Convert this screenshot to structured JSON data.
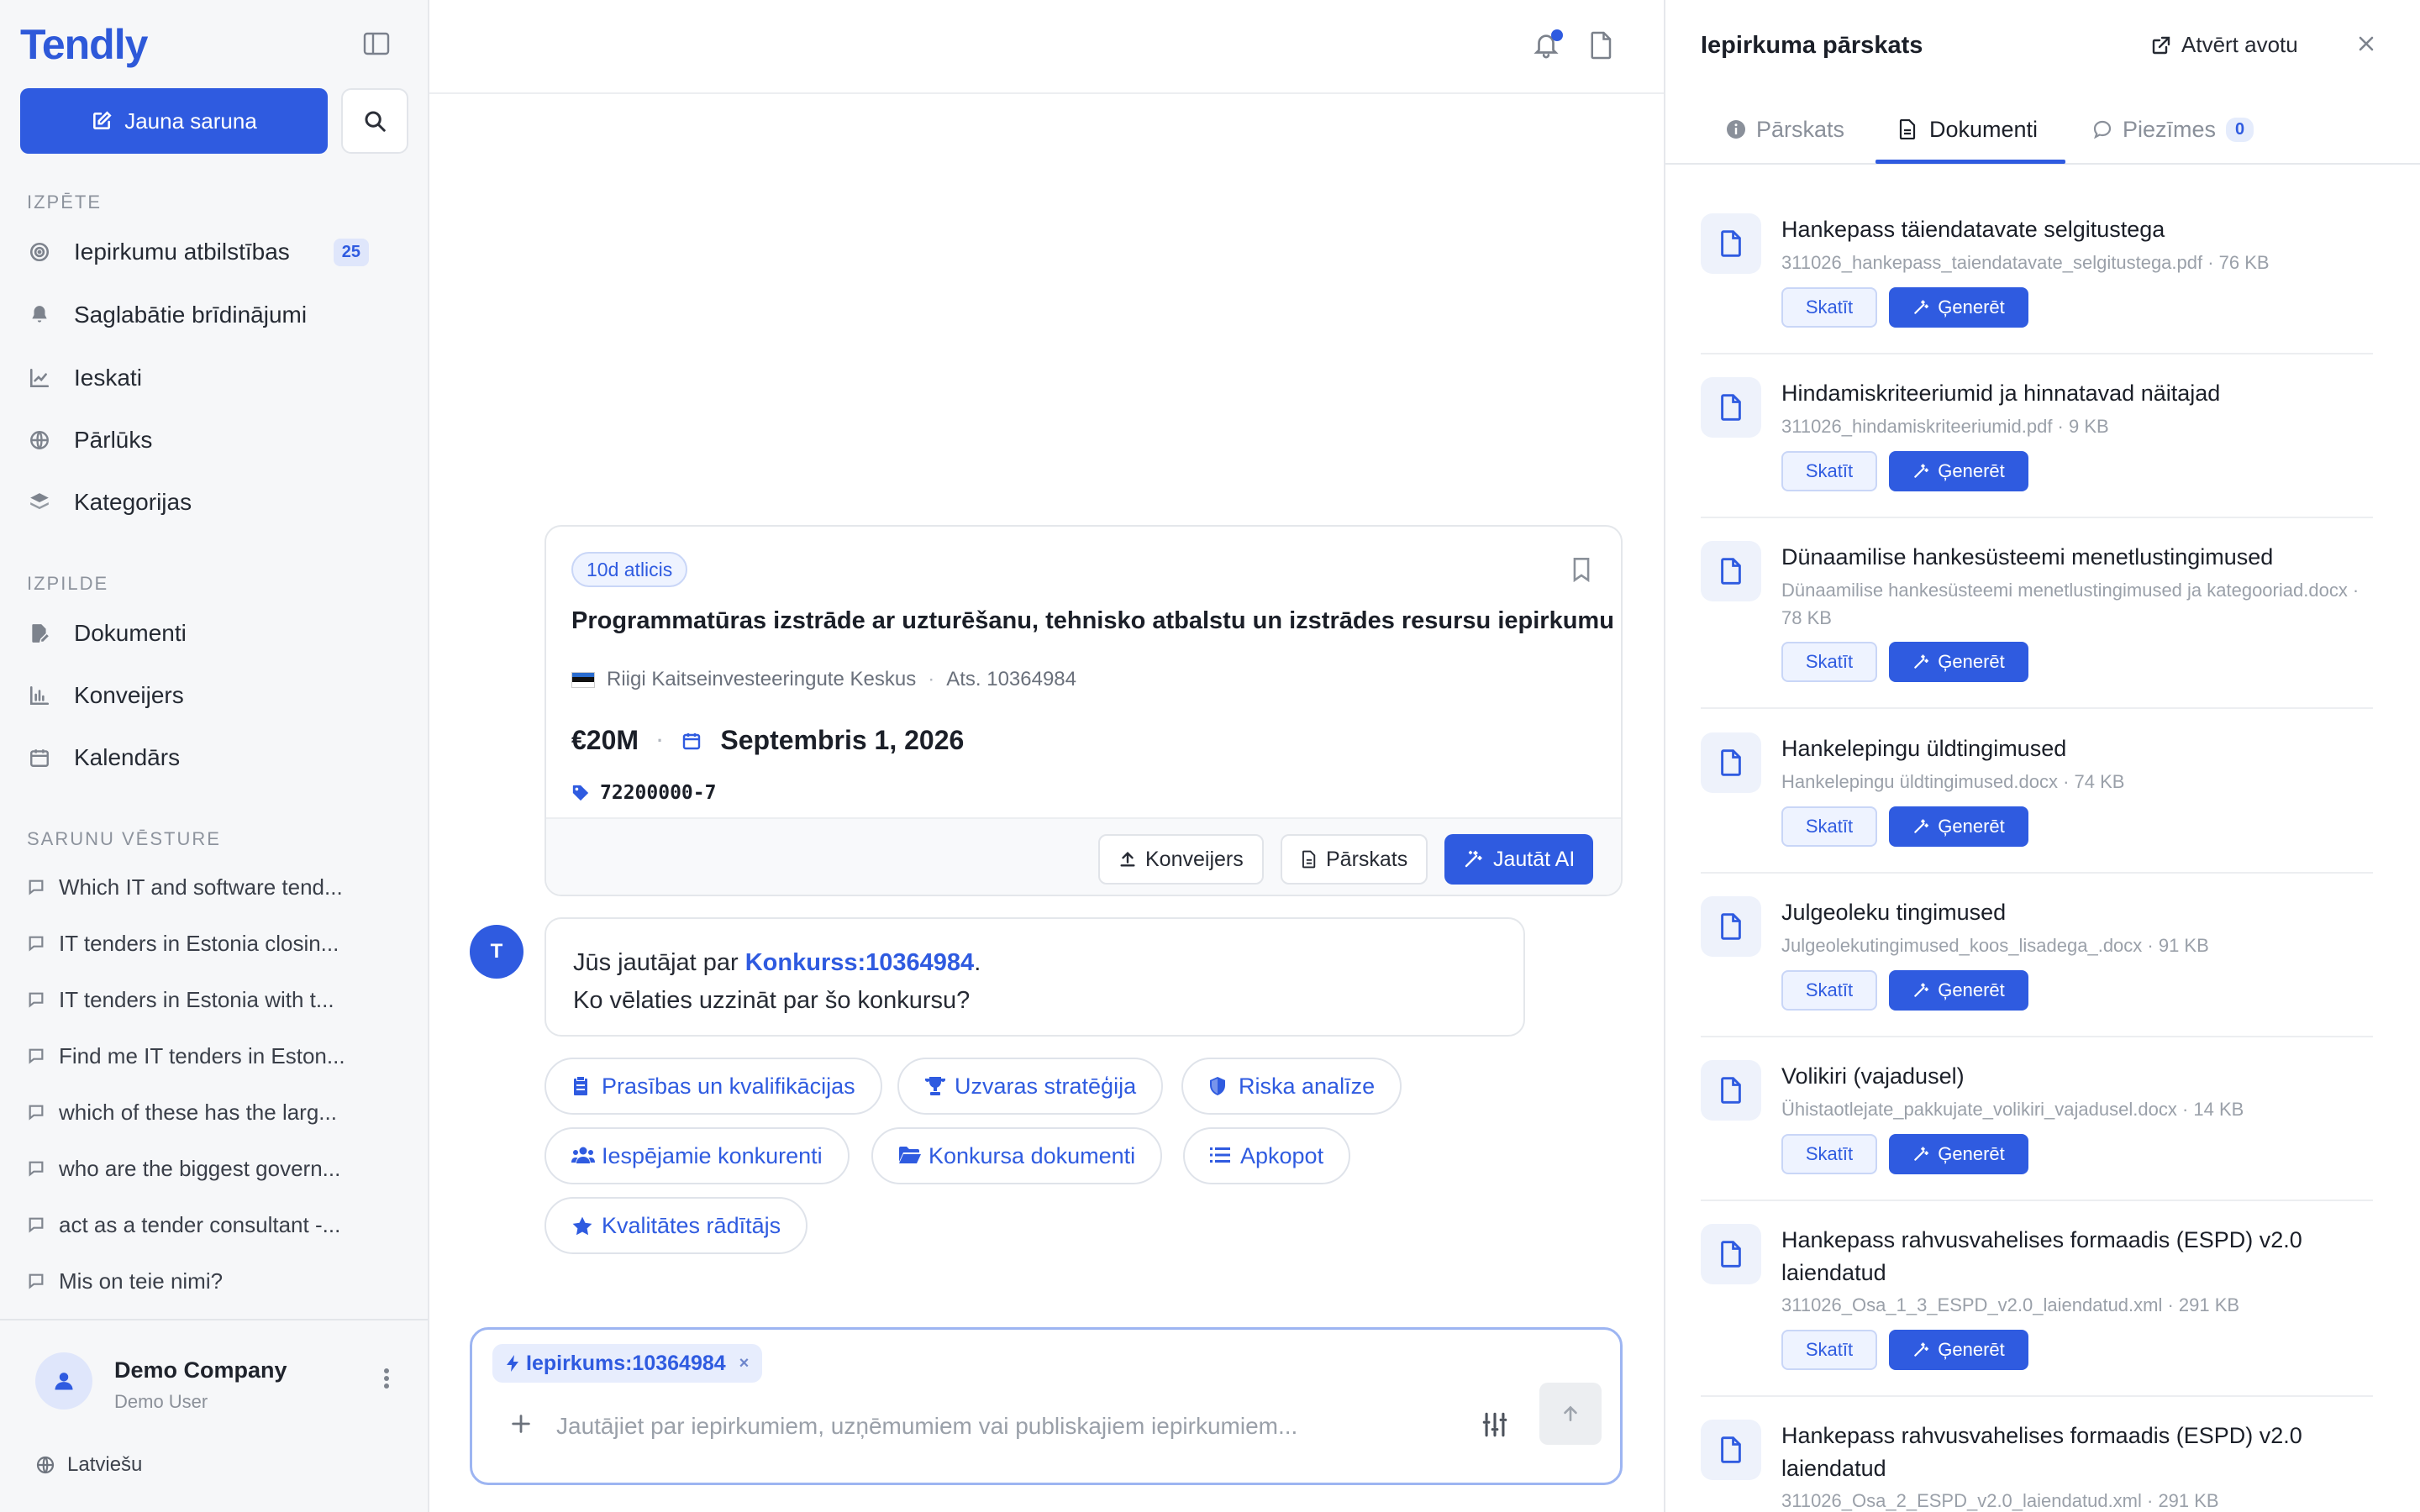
{
  "sidebar": {
    "logo": "Tendly",
    "new_chat_label": "Jauna saruna",
    "section_explore": "IZPĒTE",
    "explore_items": [
      {
        "label": "Iepirkumu atbilstības",
        "count": "25",
        "icon": "target-icon"
      },
      {
        "label": "Saglabātie brīdinājumi",
        "icon": "bell-icon"
      },
      {
        "label": "Ieskati",
        "icon": "line-chart-icon"
      },
      {
        "label": "Pārlūks",
        "icon": "globe-icon"
      },
      {
        "label": "Kategorijas",
        "icon": "layers-icon"
      }
    ],
    "section_execution": "IZPILDE",
    "execution_items": [
      {
        "label": "Dokumenti",
        "icon": "file-edit-icon"
      },
      {
        "label": "Konveijers",
        "icon": "bar-chart-icon"
      },
      {
        "label": "Kalendārs",
        "icon": "calendar-icon"
      }
    ],
    "section_history": "SARUNU VĒSTURE",
    "history": [
      "Which IT and software tend...",
      "IT tenders in Estonia closin...",
      "IT tenders in Estonia with t...",
      "Find me IT tenders in Eston...",
      "which of these has the larg...",
      "who are the biggest govern...",
      "act as a tender consultant -...",
      "Mis on teie nimi?"
    ],
    "user_name": "Demo Company",
    "user_role": "Demo User",
    "language": "Latviešu"
  },
  "tender": {
    "deadline_badge": "10d atlicis",
    "title": "Programmatūras izstrāde ar uzturēšanu, tehnisko atbalstu un izstrādes resursu iepirkumu",
    "buyer": "Riigi Kaitseinvesteeringute Keskus",
    "reference": "Ats. 10364984",
    "value": "€20M",
    "deadline_date": "Septembris 1, 2026",
    "cpv": "72200000-7",
    "actions": {
      "pipeline": "Konveijers",
      "overview": "Pārskats",
      "ask_ai": "Jautāt AI"
    }
  },
  "message": {
    "avatar": "T",
    "line1_prefix": "Jūs jautājat par ",
    "link": "Konkurss:10364984",
    "line1_suffix": ".",
    "line2": "Ko vēlaties uzzināt par šo konkursu?"
  },
  "suggestions": [
    {
      "label": "Prasības un kvalifikācijas",
      "icon": "clipboard-icon"
    },
    {
      "label": "Uzvaras stratēģija",
      "icon": "trophy-icon"
    },
    {
      "label": "Riska analīze",
      "icon": "shield-icon"
    },
    {
      "label": "Iespējamie konkurenti",
      "icon": "users-icon"
    },
    {
      "label": "Konkursa dokumenti",
      "icon": "folder-open-icon"
    },
    {
      "label": "Apkopot",
      "icon": "list-icon"
    },
    {
      "label": "Kvalitātes rādītājs",
      "icon": "star-icon"
    }
  ],
  "composer": {
    "context_chip": "Iepirkums:10364984",
    "placeholder": "Jautājiet par iepirkumiem, uzņēmumiem vai publiskajiem iepirkumiem...",
    "value": ""
  },
  "panel": {
    "title": "Iepirkuma pārskats",
    "open_source": "Atvērt avotu",
    "tabs": {
      "overview": "Pārskats",
      "documents": "Dokumenti",
      "notes": "Piezīmes",
      "notes_count": "0"
    },
    "view_label": "Skatīt",
    "generate_label": "Ģenerēt",
    "documents": [
      {
        "title": "Hankepass täiendatavate selgitustega",
        "meta": "311026_hankepass_taiendatavate_selgitustega.pdf · 76 KB"
      },
      {
        "title": "Hindamiskriteeriumid ja hinnatavad näitajad",
        "meta": "311026_hindamiskriteeriumid.pdf · 9 KB"
      },
      {
        "title": "Dünaamilise hankesüsteemi menetlustingimused",
        "meta": "Dünaamilise hankesüsteemi menetlustingimused ja kategooriad.docx · 78 KB"
      },
      {
        "title": "Hankelepingu üldtingimused",
        "meta": "Hankelepingu üldtingimused.docx · 74 KB"
      },
      {
        "title": "Julgeoleku tingimused",
        "meta": "Julgeolekutingimused_koos_lisadega_.docx · 91 KB"
      },
      {
        "title": "Volikiri (vajadusel)",
        "meta": "Ühistaotlejate_pakkujate_volikiri_vajadusel.docx · 14 KB"
      },
      {
        "title": "Hankepass rahvusvahelises formaadis (ESPD) v2.0 laiendatud",
        "meta": "311026_Osa_1_3_ESPD_v2.0_laiendatud.xml · 291 KB"
      },
      {
        "title": "Hankepass rahvusvahelises formaadis (ESPD) v2.0 laiendatud",
        "meta": "311026_Osa_2_ESPD_v2.0_laiendatud.xml · 291 KB"
      }
    ]
  },
  "colors": {
    "accent": "#2f5be0",
    "accent_light": "#eef3ff",
    "sidebar_bg": "#f6f7f9"
  }
}
